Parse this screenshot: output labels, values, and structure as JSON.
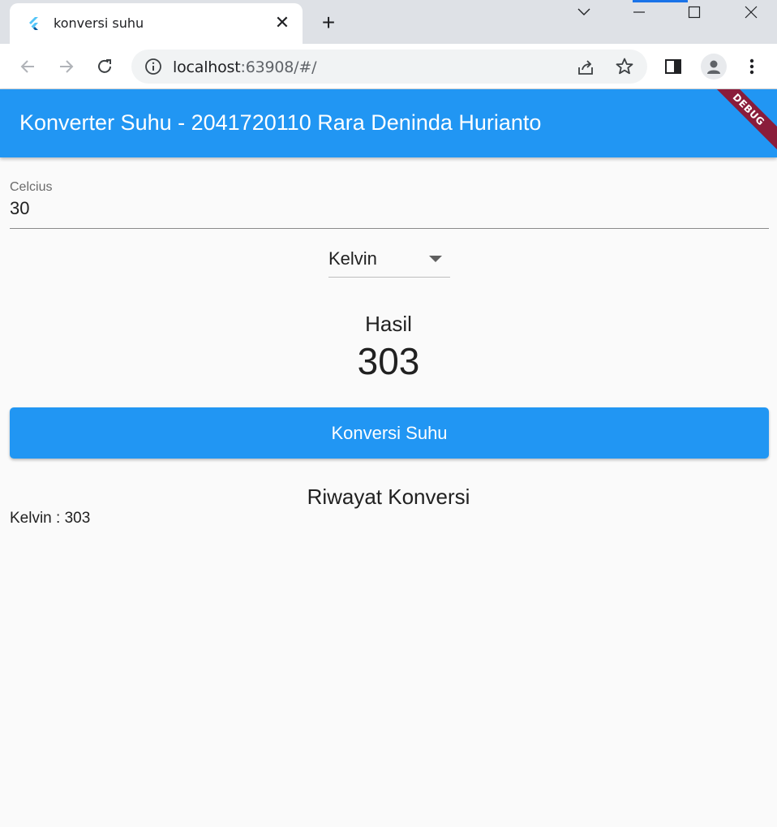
{
  "browser": {
    "tab_title": "konversi suhu",
    "url_host": "localhost",
    "url_rest": ":63908/#/"
  },
  "app": {
    "title": "Konverter Suhu - 2041720110 Rara Deninda Hurianto",
    "debug_banner": "DEBUG",
    "input": {
      "label": "Celcius",
      "value": "30"
    },
    "dropdown": {
      "selected": "Kelvin"
    },
    "result": {
      "label": "Hasil",
      "value": "303"
    },
    "convert_button": "Konversi Suhu",
    "history": {
      "title": "Riwayat Konversi",
      "items": [
        "Kelvin : 303"
      ]
    },
    "colors": {
      "primary": "#2196f3",
      "background": "#fafafa"
    }
  }
}
